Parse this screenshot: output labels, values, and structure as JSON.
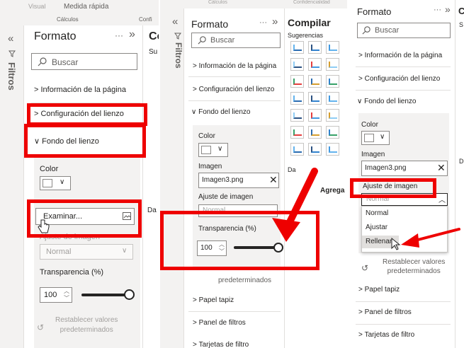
{
  "p1": {
    "tab_visual": "Visual",
    "tab_quick": "Medida rápida",
    "tab_calc": "Cálculos",
    "tab_conf": "Confi",
    "filters": "Filtros",
    "title": "Formato",
    "more": "···",
    "right_cut": "Co",
    "right_cut2": "Su",
    "right_cut3": "Da",
    "search": "Buscar",
    "sections": [
      "Información de la página",
      "Configuración del lienzo",
      "Fondo del lienzo"
    ],
    "color_label": "Color",
    "browse": "Examinar...",
    "fit_label": "Ajuste de imagen",
    "fit_value": "Normal",
    "transparency_label": "Transparencia (%)",
    "transparency_value": "100",
    "reset": "Restablecer valores\npredeterminados"
  },
  "p2": {
    "filters": "Filtros",
    "title": "Formato",
    "more": "···",
    "compile_title": "Compilar",
    "compile_tab": "Cálculos",
    "compile_tab2": "Confidencialidad",
    "suggestions": "Sugerencias",
    "datos": "Da",
    "agrega": "Agrega",
    "search": "Buscar",
    "sections": [
      "Información de la página",
      "Configuración del lienzo",
      "Fondo del lienzo"
    ],
    "color_label": "Color",
    "image_label": "Imagen",
    "image_value": "Imagen3.png",
    "fit_label": "Ajuste de imagen",
    "fit_value": "Normal",
    "transparency_label": "Transparencia (%)",
    "transparency_value": "100",
    "reset_tail": "predeterminados",
    "bottom_sections": [
      "Papel tapiz",
      "Panel de filtros",
      "Tarjetas de filtro"
    ]
  },
  "p3": {
    "title": "Formato",
    "more": "···",
    "right_cut": "C",
    "right_cut2": "S",
    "right_cut3": "D",
    "search": "Buscar",
    "sections": [
      "Información de la página",
      "Configuración del lienzo",
      "Fondo del lienzo"
    ],
    "color_label": "Color",
    "image_label": "Imagen",
    "image_value": "Imagen3.png",
    "fit_label": "Ajuste de imagen",
    "fit_value": "Normal",
    "options": [
      "Normal",
      "Ajustar",
      "Rellenar"
    ],
    "reset": "Restablecer valores\npredeterminados",
    "bottom_sections": [
      "Papel tapiz",
      "Panel de filtros",
      "Tarjetas de filtro"
    ]
  },
  "colors": {
    "highlight": "#e00000",
    "accent": "#e00000",
    "panel": "#f3f2f1",
    "selected": "#c8c6c4"
  },
  "icons": [
    "collapse-icon",
    "expand-icon",
    "filter-icon",
    "search-icon",
    "chevron-right-icon",
    "chevron-down-icon",
    "image-icon",
    "close-icon",
    "reset-icon",
    "cursor-icon",
    "arrow-icon"
  ]
}
